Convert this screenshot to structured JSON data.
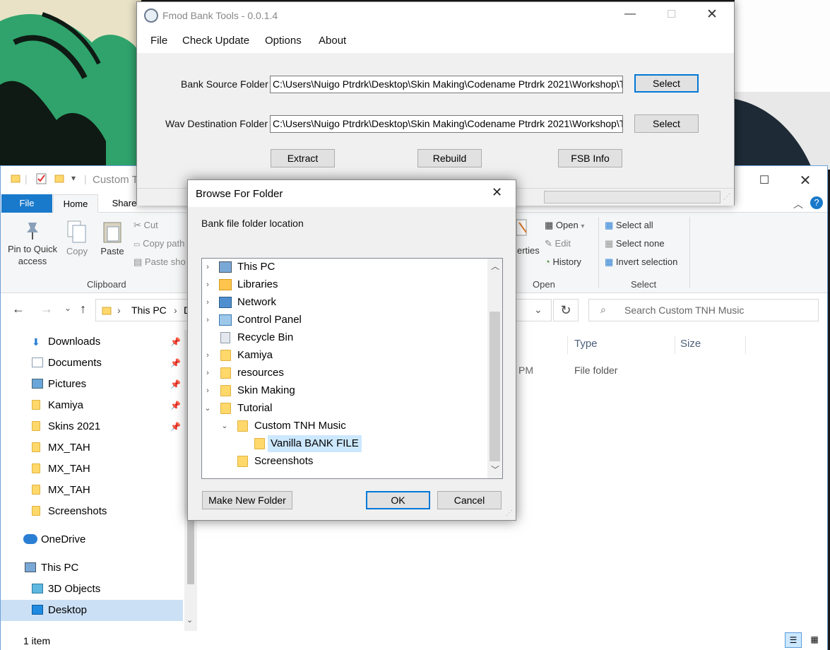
{
  "fmod": {
    "title": "Fmod Bank Tools - 0.0.1.4",
    "menu": [
      "File",
      "Check Update",
      "Options",
      "About"
    ],
    "source_label": "Bank Source Folder",
    "source_value": "C:\\Users\\Nuigo Ptrdrk\\Desktop\\Skin Making\\Codename Ptrdrk 2021\\Workshop\\TNH Music",
    "dest_label": "Wav Destination Folder",
    "dest_value": "C:\\Users\\Nuigo Ptrdrk\\Desktop\\Skin Making\\Codename Ptrdrk 2021\\Workshop\\TNH Music",
    "select_label": "Select",
    "extract_label": "Extract",
    "rebuild_label": "Rebuild",
    "fsbinfo_label": "FSB Info"
  },
  "browse": {
    "title": "Browse For Folder",
    "description": "Bank file folder location",
    "tree": [
      {
        "label": "This PC",
        "icon": "computer-icon"
      },
      {
        "label": "Libraries",
        "icon": "libraries-icon"
      },
      {
        "label": "Network",
        "icon": "network-icon"
      },
      {
        "label": "Control Panel",
        "icon": "control-panel-icon"
      },
      {
        "label": "Recycle Bin",
        "icon": "recycle-bin-icon"
      },
      {
        "label": "Kamiya",
        "icon": "folder-icon"
      },
      {
        "label": "resources",
        "icon": "folder-icon"
      },
      {
        "label": "Skin Making",
        "icon": "folder-icon"
      },
      {
        "label": "Tutorial",
        "icon": "folder-icon"
      },
      {
        "label": "Custom TNH Music",
        "icon": "folder-icon"
      },
      {
        "label": "Vanilla BANK FILE",
        "icon": "folder-icon",
        "selected": true
      },
      {
        "label": "Screenshots",
        "icon": "folder-icon"
      }
    ],
    "make_folder_label": "Make New Folder",
    "ok_label": "OK",
    "cancel_label": "Cancel"
  },
  "explorer": {
    "title": "Custom T",
    "tabs": [
      "File",
      "Home",
      "Share"
    ],
    "ribbon": {
      "pin_label": "Pin to Quick access",
      "copy_label": "Copy",
      "paste_label": "Paste",
      "cut_label": "Cut",
      "copy_path_label": "Copy path",
      "paste_shortcut_label": "Paste sho",
      "clipboard_group": "Clipboard",
      "properties_label": "erties",
      "open_label": "Open",
      "edit_label": "Edit",
      "history_label": "History",
      "open_group": "Open",
      "select_all_label": "Select all",
      "select_none_label": "Select none",
      "invert_label": "Invert selection",
      "select_group": "Select"
    },
    "address": {
      "this_pc": "This PC",
      "partial": "D"
    },
    "search_placeholder": "Search Custom TNH Music",
    "nav": [
      {
        "label": "Downloads",
        "pinned": true
      },
      {
        "label": "Documents",
        "pinned": true
      },
      {
        "label": "Pictures",
        "pinned": true
      },
      {
        "label": "Kamiya",
        "pinned": true
      },
      {
        "label": "Skins 2021",
        "pinned": true
      },
      {
        "label": "MX_TAH",
        "pinned": false
      },
      {
        "label": "MX_TAH",
        "pinned": false
      },
      {
        "label": "MX_TAH",
        "pinned": false
      },
      {
        "label": "Screenshots",
        "pinned": false
      },
      {
        "label": "OneDrive",
        "pinned": false
      },
      {
        "label": "This PC",
        "pinned": false
      },
      {
        "label": "3D Objects",
        "pinned": false
      },
      {
        "label": "Desktop",
        "pinned": false
      }
    ],
    "columns": {
      "type": "Type",
      "size": "Size"
    },
    "row": {
      "time_partial": "PM",
      "type": "File folder"
    },
    "status": "1 item"
  },
  "colors": {
    "accent": "#0078d7",
    "ribbon_file": "#1979ca",
    "selection": "#cce8ff",
    "folder": "#ffd86b"
  }
}
